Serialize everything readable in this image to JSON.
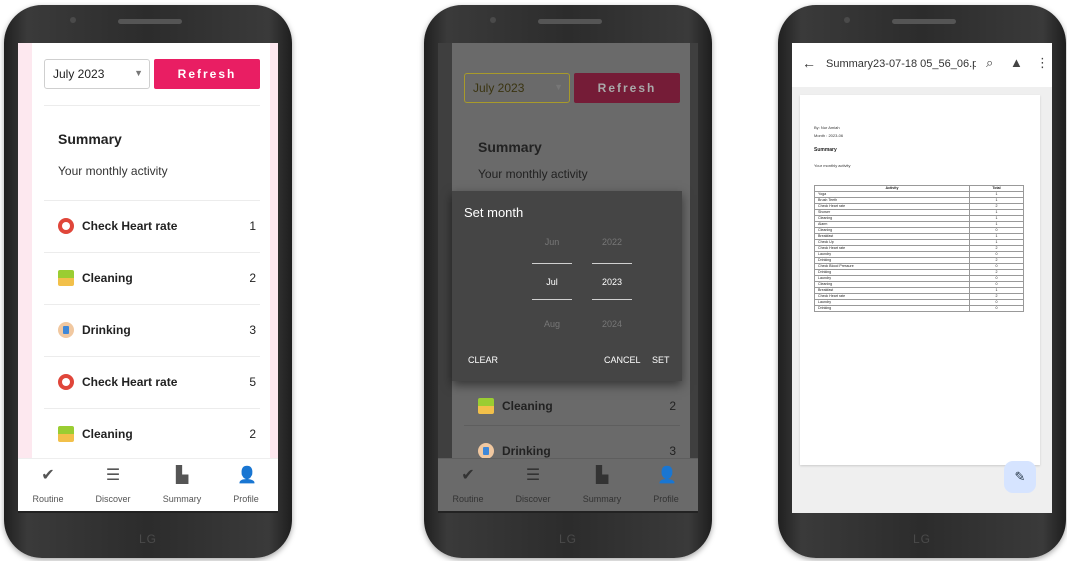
{
  "app": {
    "month_select": "July 2023",
    "refresh_label": "Refresh",
    "summary_title": "Summary",
    "summary_subtitle": "Your monthly activity",
    "activities": [
      {
        "label": "Check Heart rate",
        "count": "1",
        "icon": "heart-icon"
      },
      {
        "label": "Cleaning",
        "count": "2",
        "icon": "cleaning-icon"
      },
      {
        "label": "Drinking",
        "count": "3",
        "icon": "drinking-icon"
      },
      {
        "label": "Check Heart rate",
        "count": "5",
        "icon": "heart-icon"
      },
      {
        "label": "Cleaning",
        "count": "2",
        "icon": "cleaning-icon"
      }
    ],
    "nav": [
      {
        "label": "Routine",
        "icon": "check-circle-icon"
      },
      {
        "label": "Discover",
        "icon": "list-icon"
      },
      {
        "label": "Summary",
        "icon": "bar-chart-icon"
      },
      {
        "label": "Profile",
        "icon": "profile-icon"
      }
    ],
    "brand": "LG"
  },
  "dialog": {
    "title": "Set month",
    "months": [
      "Jun",
      "Jul",
      "Aug"
    ],
    "years": [
      "2022",
      "2023",
      "2024"
    ],
    "clear_label": "CLEAR",
    "cancel_label": "CANCEL",
    "set_label": "SET",
    "behind_rows": [
      {
        "label": "Cleaning",
        "count": "2"
      },
      {
        "label": "Drinking",
        "count": "3"
      }
    ]
  },
  "pdf": {
    "file_name": "Summary23-07-18 05_56_06.p...",
    "by_line": "By: Nur Amiah",
    "month_line": "Month : 2023-06",
    "heading": "Summary",
    "subheading": "Your monthly activity",
    "col_activity": "Activity",
    "col_total": "Total",
    "rows": [
      [
        "Yoga",
        "1"
      ],
      [
        "Brush Teeth",
        "1"
      ],
      [
        "Check Heart rate",
        "2"
      ],
      [
        "Shower",
        "1"
      ],
      [
        "Cleaning",
        "1"
      ],
      [
        "Alarm",
        "1"
      ],
      [
        "Cleaning",
        "0"
      ],
      [
        "Breakfast",
        "1"
      ],
      [
        "Check Up",
        "1"
      ],
      [
        "Check Heart rate",
        "2"
      ],
      [
        "Laundry",
        "0"
      ],
      [
        "Drinking",
        "2"
      ],
      [
        "Check Blood Pressure",
        "0"
      ],
      [
        "Drinking",
        "2"
      ],
      [
        "Laundry",
        "0"
      ],
      [
        "Cleaning",
        "0"
      ],
      [
        "Breakfast",
        "1"
      ],
      [
        "Check Heart rate",
        "2"
      ],
      [
        "Laundry",
        "0"
      ],
      [
        "Drinking",
        "0"
      ]
    ]
  },
  "colors": {
    "accent": "#e91e63",
    "background": "#fde8ef"
  }
}
